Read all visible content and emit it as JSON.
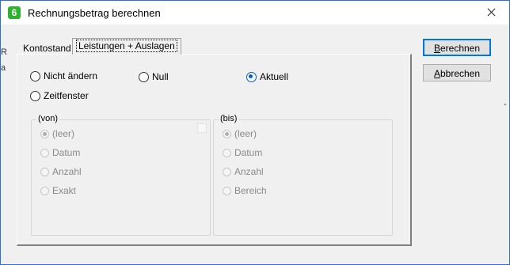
{
  "window": {
    "title": "Rechnungsbetrag berechnen",
    "app_icon_glyph": "6",
    "accent": "#2b6fd6"
  },
  "tabs": [
    {
      "label": "Kontostand",
      "active": false
    },
    {
      "label": "Leistungen + Auslagen",
      "active": true
    }
  ],
  "mode_radios": {
    "nicht_aendern": {
      "label": "Nicht ändern",
      "checked": false
    },
    "null": {
      "label": "Null",
      "checked": false
    },
    "aktuell": {
      "label": "Aktuell",
      "checked": true
    },
    "zeitfenster": {
      "label": "Zeitfenster",
      "checked": false
    }
  },
  "von_group": {
    "legend": "(von)",
    "options": [
      {
        "label": "(leer)",
        "checked": true
      },
      {
        "label": "Datum",
        "checked": false
      },
      {
        "label": "Anzahl",
        "checked": false
      },
      {
        "label": "Exakt",
        "checked": false
      }
    ]
  },
  "bis_group": {
    "legend": "(bis)",
    "options": [
      {
        "label": "(leer)",
        "checked": true
      },
      {
        "label": "Datum",
        "checked": false
      },
      {
        "label": "Anzahl",
        "checked": false
      },
      {
        "label": "Bereich",
        "checked": false
      }
    ]
  },
  "buttons": {
    "berechnen": {
      "label_u": "B",
      "label_rest": "erechnen"
    },
    "abbrechen": {
      "label_u": "A",
      "label_rest": "bbrechen"
    }
  },
  "background_fragments": {
    "left_r": "R",
    "left_a": "a",
    "right_dash": "-"
  },
  "colors": {
    "selected_radio": "#0060c0",
    "default_button_border": "#0078d7"
  }
}
